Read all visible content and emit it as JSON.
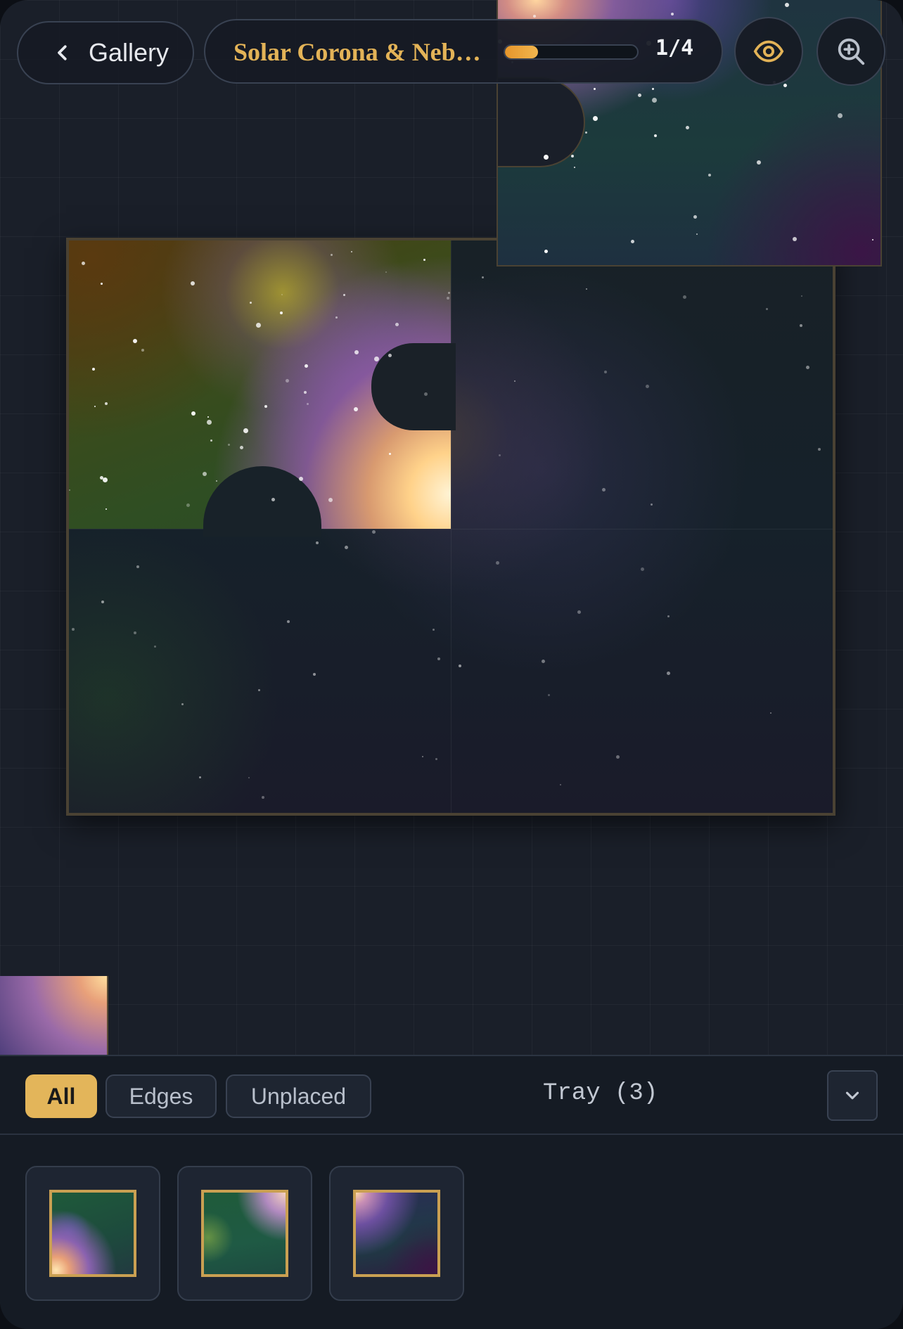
{
  "puzzle": {
    "title": "Solar Corona & Nebula",
    "progress_text": "1/4",
    "progress_fraction": 0.25
  },
  "topbar": {
    "back_label": "Gallery",
    "back_icon": "chevron-left-icon",
    "preview_icon": "eye-icon",
    "zoom_icon": "zoom-in-icon"
  },
  "tray": {
    "filters": [
      {
        "label": "All",
        "active": true
      },
      {
        "label": "Edges",
        "active": false
      },
      {
        "label": "Unplaced",
        "active": false
      }
    ],
    "label": "Tray (3)",
    "collapse_icon": "chevron-down-icon",
    "pieces": [
      {
        "name": "tray-piece-1"
      },
      {
        "name": "tray-piece-2"
      },
      {
        "name": "tray-piece-3"
      }
    ]
  },
  "colors": {
    "accent": "#e3b357",
    "progress": "#f2b64e",
    "background": "#1a1f29",
    "panel": "#151b24"
  }
}
